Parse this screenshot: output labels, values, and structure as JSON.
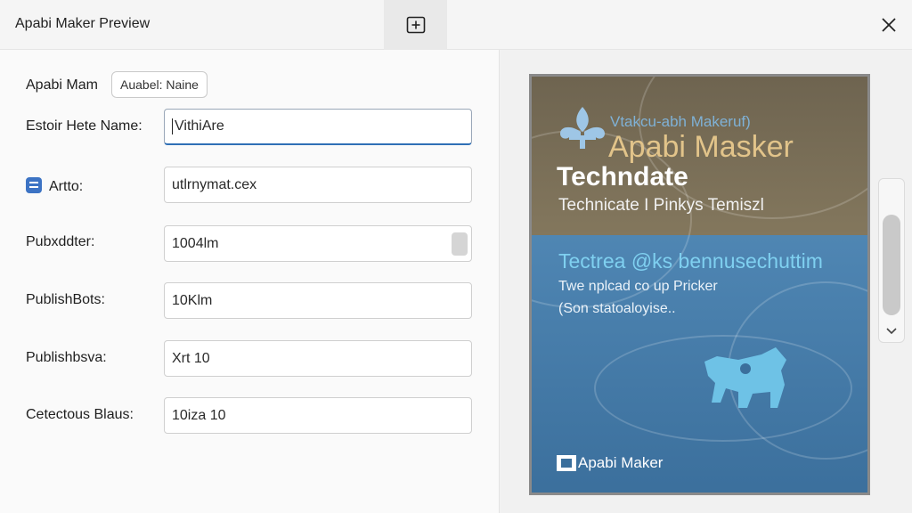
{
  "window": {
    "title": "Apabi Maker Preview",
    "icons": {
      "new_tab": "plus-square-icon",
      "close": "close-icon"
    }
  },
  "form": {
    "name_label": "Apabi Mam",
    "name_chip": "Auabel: Naine",
    "rows": [
      {
        "label": "Estoir Hete Name:",
        "value": "VithiAre"
      },
      {
        "label": "Artto:",
        "value": "utlrnymat.cex",
        "icon": "app-list-icon"
      },
      {
        "label": "Pubxddter:",
        "value": "1004lm"
      },
      {
        "label": "PublishBots:",
        "value": "10Klm"
      },
      {
        "label": "Publishbsva:",
        "value": "Xrt 10"
      },
      {
        "label": "Cetectous Blaus:",
        "value": "10iza 10"
      }
    ]
  },
  "cover": {
    "subtitle": "Vtakcu-abh Makeruf)",
    "big_title": "Apabi Masker",
    "tech_title": "Techndate",
    "tech_subtitle": "Technicate I Pinkys Temiszl",
    "heading": "Tectrea @ks bennusechuttim",
    "line1": "Twe nplcad co up Pricker",
    "line2": "(Son statoaloyise..",
    "brand": "Apabi Maker",
    "colors": {
      "top": "#7a6f57",
      "bottom": "#4a80ad",
      "accent": "#7fd0f0",
      "gold": "#e2c48a"
    }
  },
  "scrollbar": {
    "icons": {
      "down": "chevron-down-icon"
    }
  }
}
